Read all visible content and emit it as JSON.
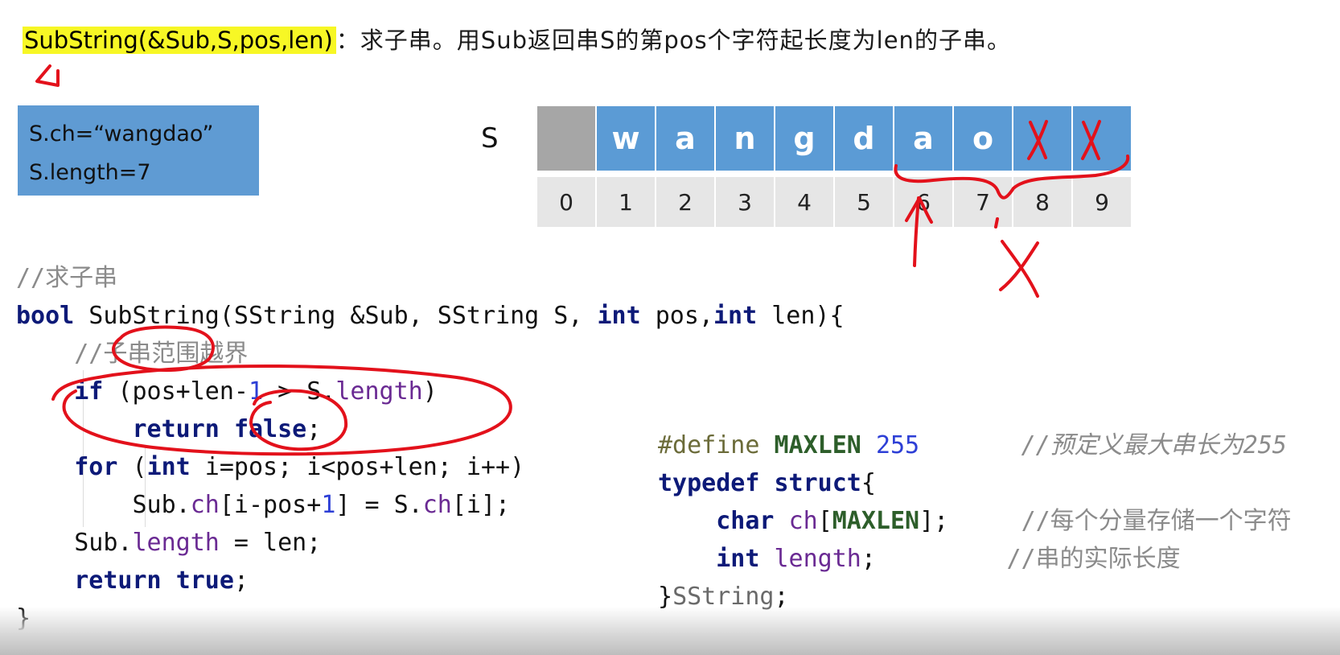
{
  "title": {
    "func": "SubString(&Sub,S,pos,len)",
    "desc": "：求子串。用Sub返回串S的第pos个字符起长度为len的子串。"
  },
  "info_box": {
    "line1": "S.ch=“wangdao”",
    "line2": "S.length=7"
  },
  "s_label": "S",
  "array": {
    "cells": [
      "",
      "w",
      "a",
      "n",
      "g",
      "d",
      "a",
      "o",
      "",
      ""
    ],
    "indices": [
      "0",
      "1",
      "2",
      "3",
      "4",
      "5",
      "6",
      "7",
      "8",
      "9"
    ]
  },
  "code_left": {
    "comment_title": "//求子串",
    "sig_bool": "bool",
    "sig_name": " SubString(SString &Sub, SString S, ",
    "sig_int1": "int",
    "sig_pos": " pos,",
    "sig_int2": "int",
    "sig_len": " len){",
    "comment_bounds": "//子串范围越界",
    "if_kw": "if",
    "if_cond_a": " (pos+len-",
    "if_one": "1",
    "if_cond_b": " > S.",
    "if_length": "length",
    "if_close": ")",
    "return_kw": "return",
    "false_kw": "false",
    "semicolon": ";",
    "for_kw": "for",
    "for_open": " (",
    "for_int": "int",
    "for_rest": " i=pos; i<pos+len; i++)",
    "assign_a": "Sub.",
    "assign_ch1": "ch",
    "assign_b": "[i-pos+",
    "assign_one": "1",
    "assign_c": "] = S.",
    "assign_ch2": "ch",
    "assign_d": "[i];",
    "len_a": "Sub.",
    "len_field": "length",
    "len_b": " = len;",
    "ret_kw": "return",
    "true_kw": "true",
    "close_brace": "}"
  },
  "code_right": {
    "define": "#define",
    "maxlen": "MAXLEN",
    "value": "255",
    "comment_define": "//预定义最大串长为255",
    "typedef": "typedef",
    "struct": "struct",
    "open_brace": "{",
    "char_kw": "char",
    "ch": "ch",
    "ch_open": "[",
    "ch_maxlen": "MAXLEN",
    "ch_close": "];",
    "comment_ch": "//每个分量存储一个字符",
    "int_kw": "int",
    "length": "length",
    "semi": ";",
    "comment_len": "//串的实际长度",
    "close": "}",
    "type_name": "SString",
    "close_semi": ";"
  },
  "colors": {
    "highlight": "#f7f725",
    "box_blue": "#5f9bd3",
    "cell_blue": "#5b9bd5",
    "cell_gray": "#a6a6a6",
    "index_gray": "#e6e6e6",
    "ink_red": "#e3111b",
    "keyword": "#0d1a78",
    "number": "#2d3fd6",
    "field": "#6a2a93"
  }
}
